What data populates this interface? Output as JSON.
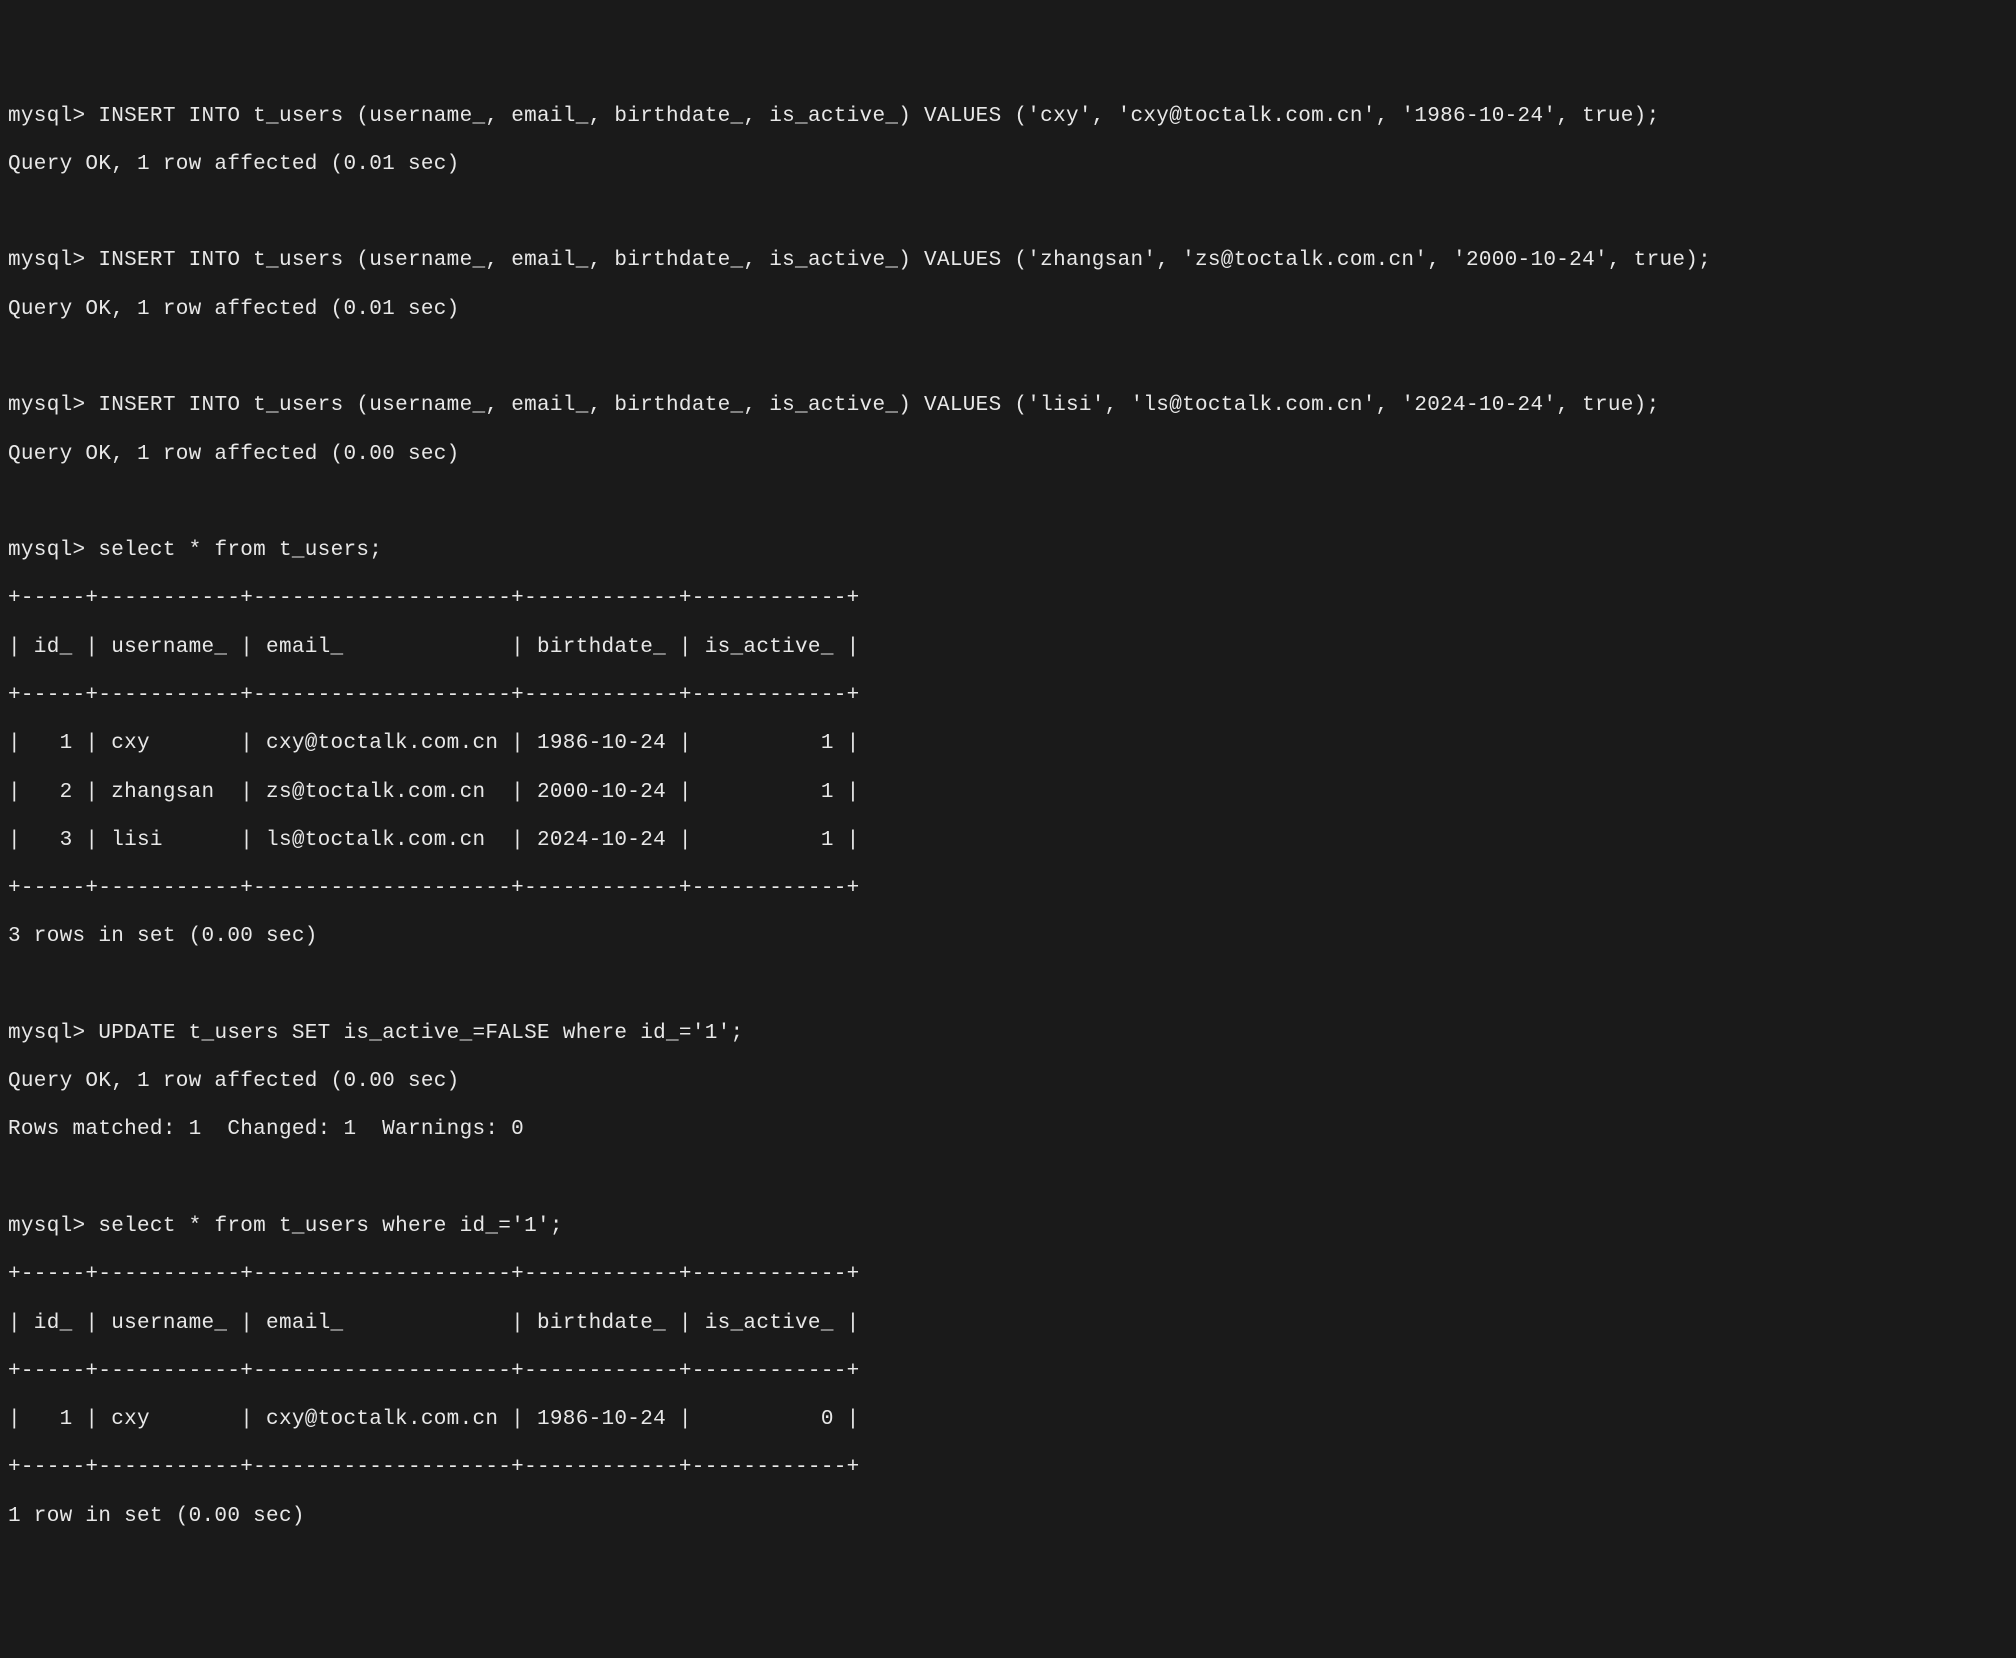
{
  "prompt": "mysql> ",
  "statements": [
    {
      "sql": "INSERT INTO t_users (username_, email_, birthdate_, is_active_) VALUES ('cxy', 'cxy@toctalk.com.cn', '1986-10-24', true);",
      "result": "Query OK, 1 row affected (0.01 sec)"
    },
    {
      "sql": "INSERT INTO t_users (username_, email_, birthdate_, is_active_) VALUES ('zhangsan', 'zs@toctalk.com.cn', '2000-10-24', true);",
      "result": "Query OK, 1 row affected (0.01 sec)"
    },
    {
      "sql": "INSERT INTO t_users (username_, email_, birthdate_, is_active_) VALUES ('lisi', 'ls@toctalk.com.cn', '2024-10-24', true);",
      "result": "Query OK, 1 row affected (0.00 sec)"
    }
  ],
  "select1": {
    "sql": "select * from t_users;",
    "border_top": "+-----+-----------+--------------------+------------+------------+",
    "header": "| id_ | username_ | email_             | birthdate_ | is_active_ |",
    "border_mid": "+-----+-----------+--------------------+------------+------------+",
    "rows": [
      "|   1 | cxy       | cxy@toctalk.com.cn | 1986-10-24 |          1 |",
      "|   2 | zhangsan  | zs@toctalk.com.cn  | 2000-10-24 |          1 |",
      "|   3 | lisi      | ls@toctalk.com.cn  | 2024-10-24 |          1 |"
    ],
    "border_bot": "+-----+-----------+--------------------+------------+------------+",
    "footer": "3 rows in set (0.00 sec)"
  },
  "update": {
    "sql": "UPDATE t_users SET is_active_=FALSE where id_='1';",
    "result1": "Query OK, 1 row affected (0.00 sec)",
    "result2": "Rows matched: 1  Changed: 1  Warnings: 0"
  },
  "select2": {
    "sql": "select * from t_users where id_='1';",
    "border_top": "+-----+-----------+--------------------+------------+------------+",
    "header": "| id_ | username_ | email_             | birthdate_ | is_active_ |",
    "border_mid": "+-----+-----------+--------------------+------------+------------+",
    "rows": [
      "|   1 | cxy       | cxy@toctalk.com.cn | 1986-10-24 |          0 |"
    ],
    "border_bot": "+-----+-----------+--------------------+------------+------------+",
    "footer": "1 row in set (0.00 sec)"
  }
}
